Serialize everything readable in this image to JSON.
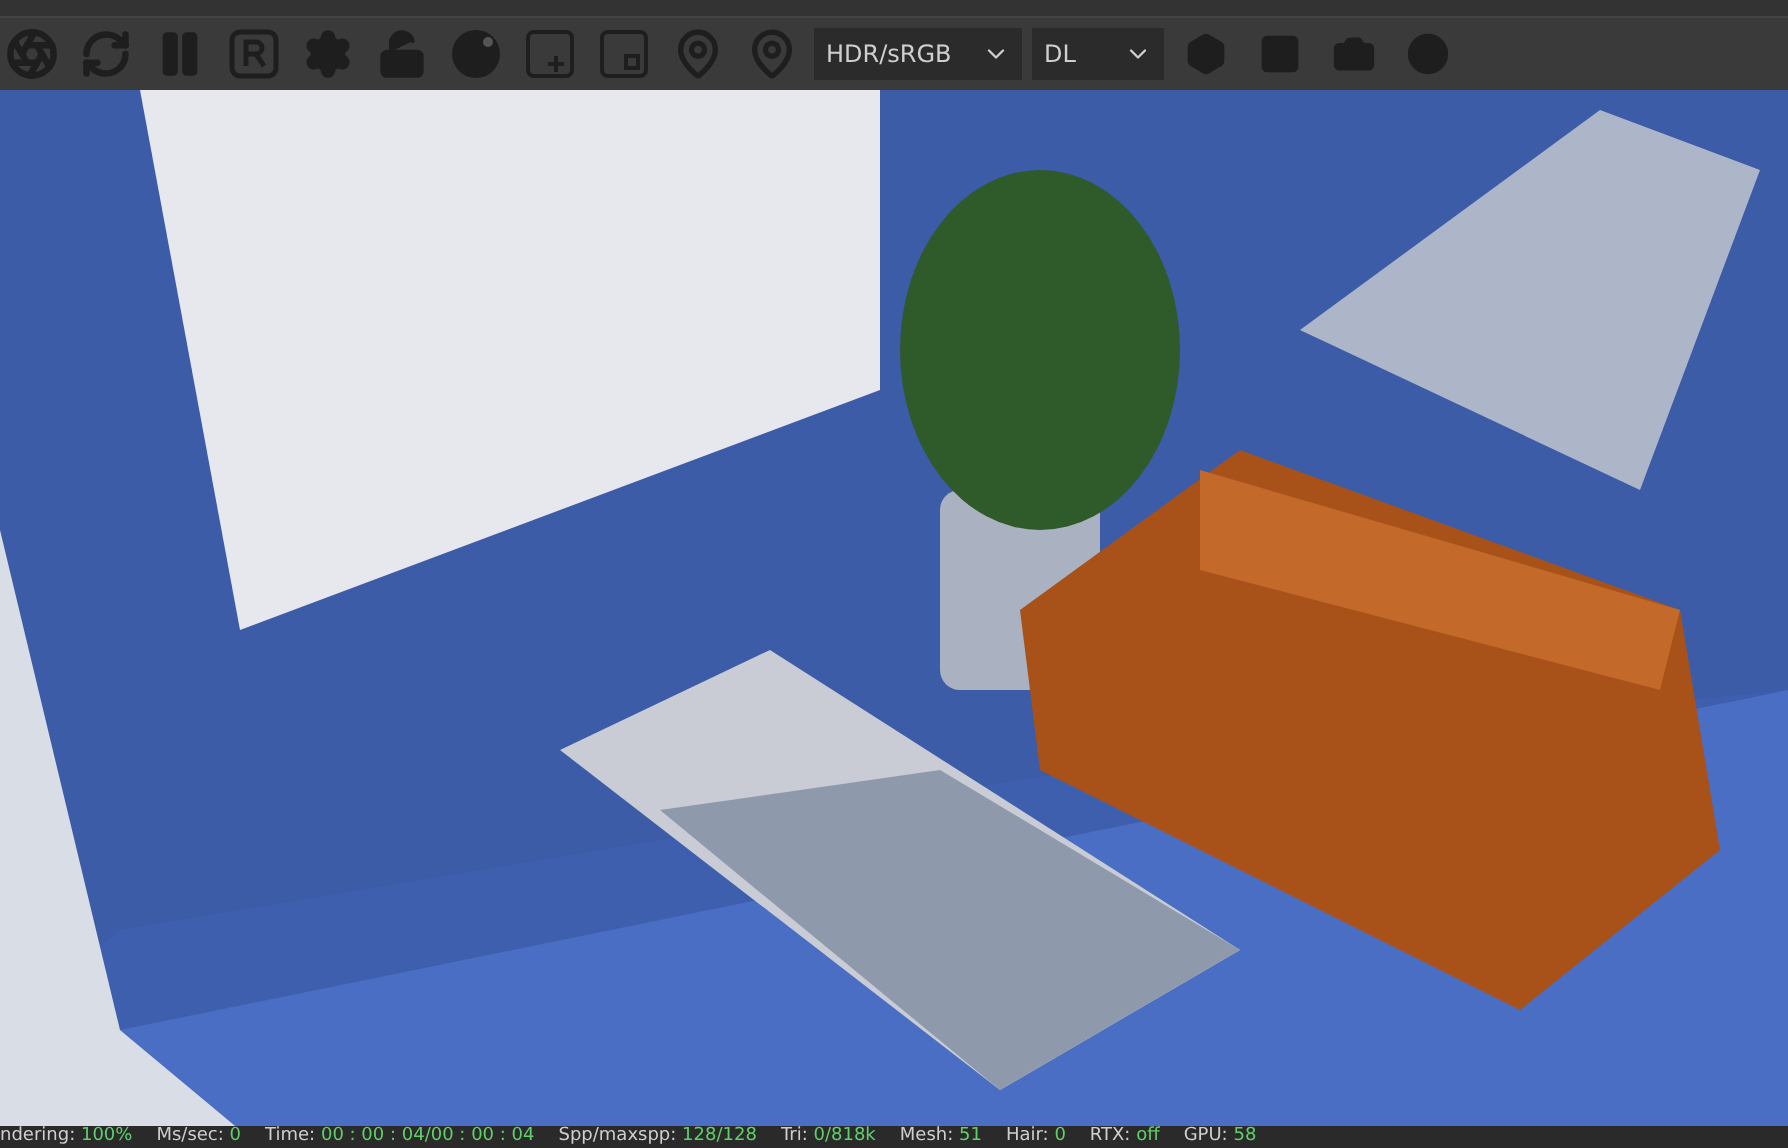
{
  "toolbar": {
    "tools": [
      {
        "kind": "logo"
      },
      {
        "kind": "refresh"
      },
      {
        "kind": "pause"
      },
      {
        "kind": "region"
      },
      {
        "kind": "gear"
      },
      {
        "kind": "lock"
      },
      {
        "kind": "sphere"
      },
      {
        "kind": "add"
      },
      {
        "kind": "frame"
      },
      {
        "kind": "pin-f"
      },
      {
        "kind": "pin-m"
      }
    ],
    "dropdowns": [
      {
        "value": "HDR/sRGB"
      },
      {
        "value": "DL"
      }
    ],
    "extras": [
      {
        "kind": "hexagon"
      },
      {
        "kind": "rect"
      },
      {
        "kind": "camera"
      },
      {
        "kind": "ball"
      }
    ]
  },
  "status_bar": [
    {
      "label": "ndering:",
      "value": "100%"
    },
    {
      "label": "Ms/sec:",
      "value": "0"
    },
    {
      "label": "Time:",
      "value": "00 : 00 : 04/00 : 00 : 04"
    },
    {
      "label": "Spp/maxspp:",
      "value": "128/128"
    },
    {
      "label": "Tri:",
      "value": "0/818k"
    },
    {
      "label": "Mesh:",
      "value": "51"
    },
    {
      "label": "Hair:",
      "value": "0"
    },
    {
      "label": "RTX:",
      "value": "off"
    },
    {
      "label": "GPU:",
      "value": "58"
    }
  ]
}
